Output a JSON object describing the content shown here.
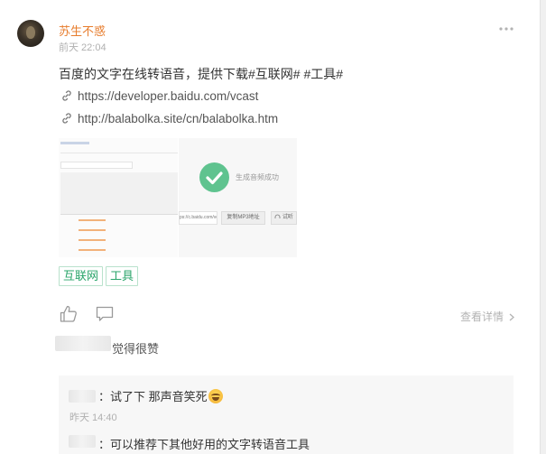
{
  "post": {
    "username": "苏生不惑",
    "time": "前天 22:04",
    "more_icon": "ellipsis-icon",
    "text": "百度的文字在线转语音，提供下载#互联网# #工具#",
    "links": [
      {
        "icon": "link-icon",
        "url": "https://developer.baidu.com/vcast"
      },
      {
        "icon": "link-icon",
        "url": "http://balabolka.site/cn/balabolka.htm"
      }
    ],
    "image_right": {
      "success_text": "生成音频成功",
      "copy_button": "复制MP3地址",
      "listen_button": "试听",
      "url_snippet": "ps://c.baidu.com/vc"
    },
    "tags": [
      "互联网",
      "工具"
    ],
    "actions": {
      "like_icon": "thumbs-up-icon",
      "comment_icon": "comment-icon",
      "detail_label": "查看详情"
    },
    "liked_label": "觉得很赞"
  },
  "comments": [
    {
      "text": "：试了下 那声音笑死",
      "emoji": "laughing-emoji",
      "time": "昨天 14:40"
    },
    {
      "text": "：可以推荐下其他好用的文字转语音工具"
    }
  ],
  "colors": {
    "username": "#e77c2c",
    "tag_text": "#2aa46a",
    "tag_border": "#b9e2cc",
    "success_green": "#5fc38f"
  }
}
